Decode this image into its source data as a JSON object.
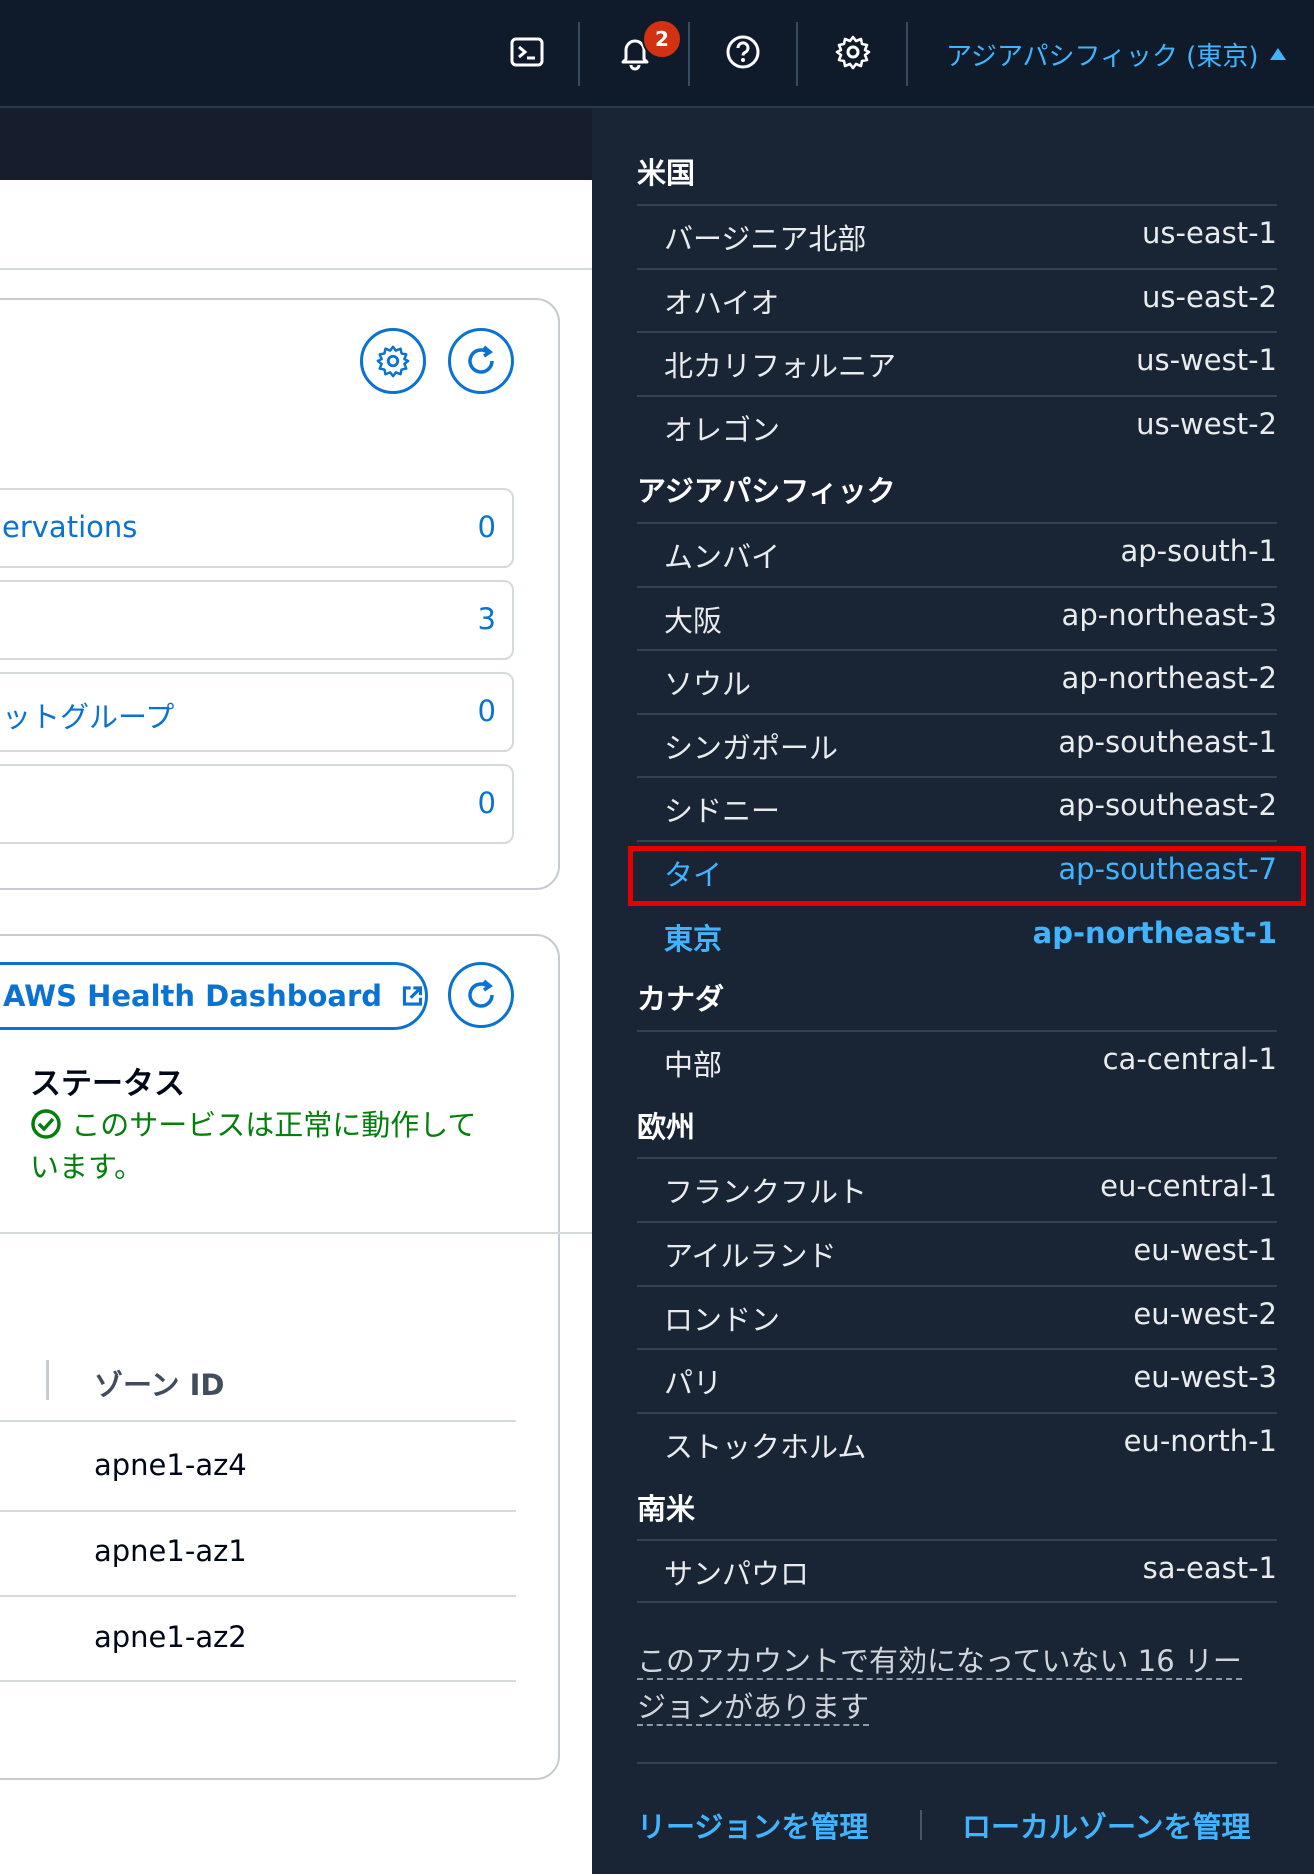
{
  "topbar": {
    "notification_count": "2",
    "region_label": "アジアパシフィック (東京)"
  },
  "resources": [
    {
      "label": "ervations",
      "count": "0"
    },
    {
      "label": "",
      "count": "3"
    },
    {
      "label": "ットグループ",
      "count": "0"
    },
    {
      "label": "",
      "count": "0"
    }
  ],
  "health": {
    "dashboard_button": "AWS Health Dashboard",
    "status_title": "ステータス",
    "status_line1": "このサービスは正常に動作して",
    "status_line2": "います。"
  },
  "zones": {
    "header": "ゾーン ID",
    "rows": [
      "apne1-az4",
      "apne1-az1",
      "apne1-az2"
    ]
  },
  "region_menu": {
    "groups": [
      {
        "name": "米国",
        "regions": [
          {
            "name": "バージニア北部",
            "code": "us-east-1"
          },
          {
            "name": "オハイオ",
            "code": "us-east-2"
          },
          {
            "name": "北カリフォルニア",
            "code": "us-west-1"
          },
          {
            "name": "オレゴン",
            "code": "us-west-2"
          }
        ]
      },
      {
        "name": "アジアパシフィック",
        "regions": [
          {
            "name": "ムンバイ",
            "code": "ap-south-1"
          },
          {
            "name": "大阪",
            "code": "ap-northeast-3"
          },
          {
            "name": "ソウル",
            "code": "ap-northeast-2"
          },
          {
            "name": "シンガポール",
            "code": "ap-southeast-1"
          },
          {
            "name": "シドニー",
            "code": "ap-southeast-2"
          },
          {
            "name": "タイ",
            "code": "ap-southeast-7"
          },
          {
            "name": "東京",
            "code": "ap-northeast-1"
          }
        ]
      },
      {
        "name": "カナダ",
        "regions": [
          {
            "name": "中部",
            "code": "ca-central-1"
          }
        ]
      },
      {
        "name": "欧州",
        "regions": [
          {
            "name": "フランクフルト",
            "code": "eu-central-1"
          },
          {
            "name": "アイルランド",
            "code": "eu-west-1"
          },
          {
            "name": "ロンドン",
            "code": "eu-west-2"
          },
          {
            "name": "パリ",
            "code": "eu-west-3"
          },
          {
            "name": "ストックホルム",
            "code": "eu-north-1"
          }
        ]
      },
      {
        "name": "南米",
        "regions": [
          {
            "name": "サンパウロ",
            "code": "sa-east-1"
          }
        ]
      }
    ],
    "notice_line1": "このアカウントで有効になっていない 16 リー",
    "notice_line2": "ジョンがあります",
    "manage_regions": "リージョンを管理",
    "manage_local_zones": "ローカルゾーンを管理"
  },
  "colors": {
    "accent": "#0972d3",
    "dark_link": "#42b4ff",
    "success": "#037f0c",
    "highlight_box": "#e50000",
    "badge": "#d13212"
  }
}
